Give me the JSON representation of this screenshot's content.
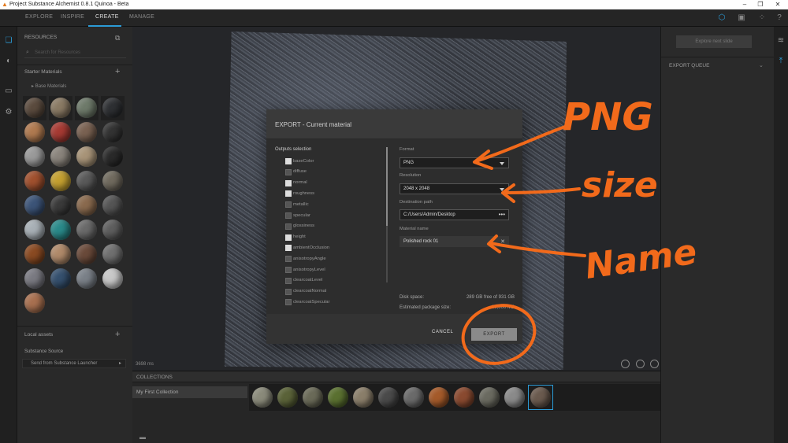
{
  "window": {
    "title": "Project Substance Alchemist 0.8.1 Quinoa - Beta"
  },
  "menu": {
    "explore": "EXPLORE",
    "inspire": "INSPIRE",
    "create": "CREATE",
    "manage": "MANAGE"
  },
  "left_panel": {
    "resources": "RESOURCES",
    "search_placeholder": "Search for Resources",
    "starter_materials": "Starter Materials",
    "base_materials": "Base Materials",
    "local_assets": "Local assets",
    "substance_source": "Substance Source",
    "launcher": "Send from Substance Launcher"
  },
  "viewport": {
    "time": "3698 ms"
  },
  "right_panel": {
    "button": "Explore next slide",
    "queue": "EXPORT QUEUE"
  },
  "collections": {
    "header": "COLLECTIONS",
    "item": "My First Collection"
  },
  "dialog": {
    "title": "EXPORT - Current material",
    "outputs_label": "Outputs selection",
    "outputs": [
      {
        "label": "baseColor",
        "checked": true
      },
      {
        "label": "diffuse",
        "checked": false
      },
      {
        "label": "normal",
        "checked": true
      },
      {
        "label": "roughness",
        "checked": true
      },
      {
        "label": "metallic",
        "checked": false
      },
      {
        "label": "specular",
        "checked": false
      },
      {
        "label": "glossiness",
        "checked": false
      },
      {
        "label": "height",
        "checked": true
      },
      {
        "label": "ambientOcclusion",
        "checked": true
      },
      {
        "label": "anisotropyAngle",
        "checked": false
      },
      {
        "label": "anisotropyLevel",
        "checked": false
      },
      {
        "label": "clearcoatLevel",
        "checked": false
      },
      {
        "label": "clearcoatNormal",
        "checked": false
      },
      {
        "label": "clearcoatSpecular",
        "checked": false
      }
    ],
    "format_label": "Format",
    "format_value": "PNG",
    "resolution_label": "Resolution",
    "resolution_value": "2048 x 2048",
    "destination_label": "Destination path",
    "destination_value": "C:/Users/Admin/Desktop",
    "material_label": "Material name",
    "material_value": "Polished rock 01",
    "disk_space_label": "Disk space:",
    "disk_space_value": "289 GB free of 931 GB",
    "package_label": "Estimated package size:",
    "package_value": "80,000 MB",
    "cancel": "CANCEL",
    "export": "EXPORT"
  },
  "annotations": {
    "png": "PNG",
    "size": "size",
    "name": "Name",
    "color": "#f26a1b"
  }
}
